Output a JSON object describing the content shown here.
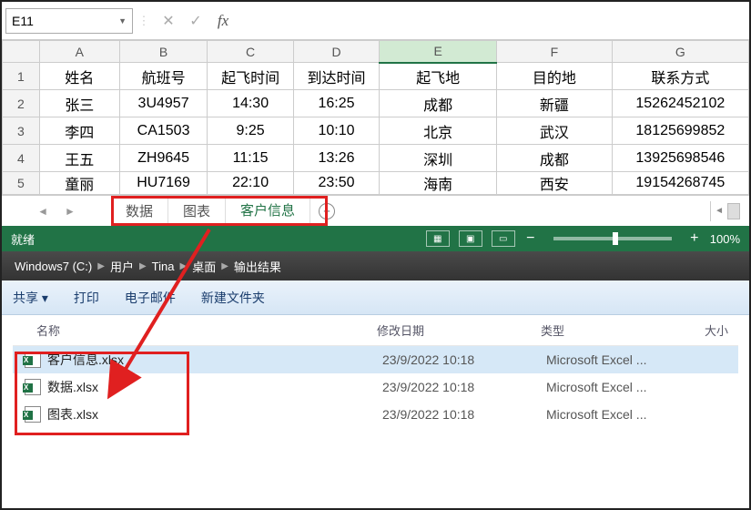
{
  "formula_bar": {
    "cell_ref": "E11",
    "fx_symbol": "fx",
    "cancel": "✕",
    "confirm": "✓"
  },
  "columns": [
    "A",
    "B",
    "C",
    "D",
    "E",
    "F",
    "G"
  ],
  "rows": [
    {
      "n": "1",
      "A": "姓名",
      "B": "航班号",
      "C": "起飞时间",
      "D": "到达时间",
      "E": "起飞地",
      "F": "目的地",
      "G": "联系方式"
    },
    {
      "n": "2",
      "A": "张三",
      "B": "3U4957",
      "C": "14:30",
      "D": "16:25",
      "E": "成都",
      "F": "新疆",
      "G": "15262452102"
    },
    {
      "n": "3",
      "A": "李四",
      "B": "CA1503",
      "C": "9:25",
      "D": "10:10",
      "E": "北京",
      "F": "武汉",
      "G": "18125699852"
    },
    {
      "n": "4",
      "A": "王五",
      "B": "ZH9645",
      "C": "11:15",
      "D": "13:26",
      "E": "深圳",
      "F": "成都",
      "G": "13925698546"
    },
    {
      "n": "5",
      "A": "童丽",
      "B": "HU7169",
      "C": "22:10",
      "D": "23:50",
      "E": "海南",
      "F": "西安",
      "G": "19154268745"
    }
  ],
  "sheet_tabs": {
    "items": [
      "数据",
      "图表",
      "客户信息"
    ],
    "active_index": 2,
    "add_tooltip": "+"
  },
  "status_bar": {
    "ready": "就绪",
    "zoom": "100%"
  },
  "breadcrumb": {
    "items": [
      "Windows7 (C:)",
      "用户",
      "Tina",
      "桌面",
      "输出结果"
    ]
  },
  "explorer_toolbar": {
    "share": "共享 ▾",
    "print": "打印",
    "email": "电子邮件",
    "new_folder": "新建文件夹"
  },
  "file_headers": {
    "name": "名称",
    "date": "修改日期",
    "type": "类型",
    "size": "大小"
  },
  "files": [
    {
      "name": "客户信息.xlsx",
      "date": "23/9/2022 10:18",
      "type": "Microsoft Excel ...",
      "selected": true
    },
    {
      "name": "数据.xlsx",
      "date": "23/9/2022 10:18",
      "type": "Microsoft Excel ...",
      "selected": false
    },
    {
      "name": "图表.xlsx",
      "date": "23/9/2022 10:18",
      "type": "Microsoft Excel ...",
      "selected": false
    }
  ]
}
